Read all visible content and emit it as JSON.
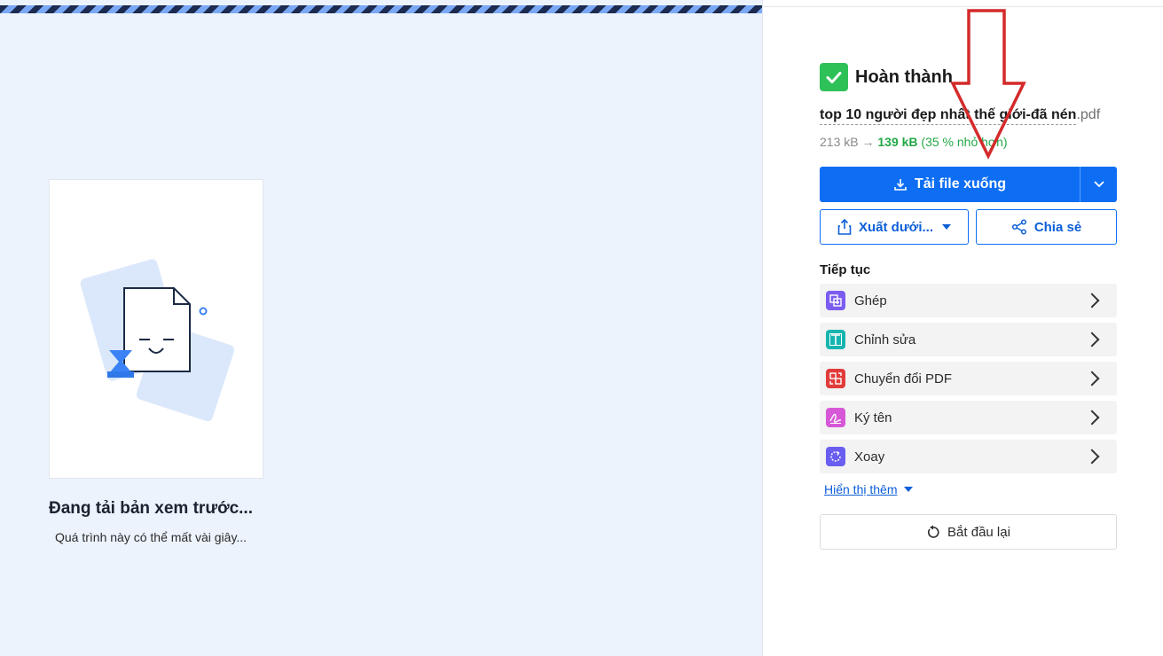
{
  "preview": {
    "loading_title": "Đang tải bản xem trước...",
    "loading_subtitle": "Quá trình này có thể mất vài giây..."
  },
  "status": {
    "label": "Hoàn thành",
    "icon": "check-icon",
    "color": "#2ec158"
  },
  "file": {
    "name": "top 10 người đẹp nhất thế giới-đã nén",
    "extension": ".pdf",
    "original_size": "213 kB",
    "new_size": "139 kB",
    "reduction": "(35 % nhỏ hơn)"
  },
  "actions": {
    "download_label": "Tải file xuống",
    "export_label": "Xuất dưới...",
    "share_label": "Chia sẻ",
    "accent_color": "#0d6ef4"
  },
  "continue": {
    "title": "Tiếp tục",
    "tools": [
      {
        "label": "Ghép",
        "icon": "merge-icon",
        "color": "#7b5cf0"
      },
      {
        "label": "Chỉnh sửa",
        "icon": "edit-text-icon",
        "color": "#16b5b0"
      },
      {
        "label": "Chuyển đổi PDF",
        "icon": "convert-icon",
        "color": "#e23b3b"
      },
      {
        "label": "Ký tên",
        "icon": "sign-icon",
        "color": "#d758d6"
      },
      {
        "label": "Xoay",
        "icon": "rotate-icon",
        "color": "#6a5ef0"
      }
    ],
    "show_more": "Hiển thị thêm",
    "restart": "Bắt đầu lại"
  }
}
